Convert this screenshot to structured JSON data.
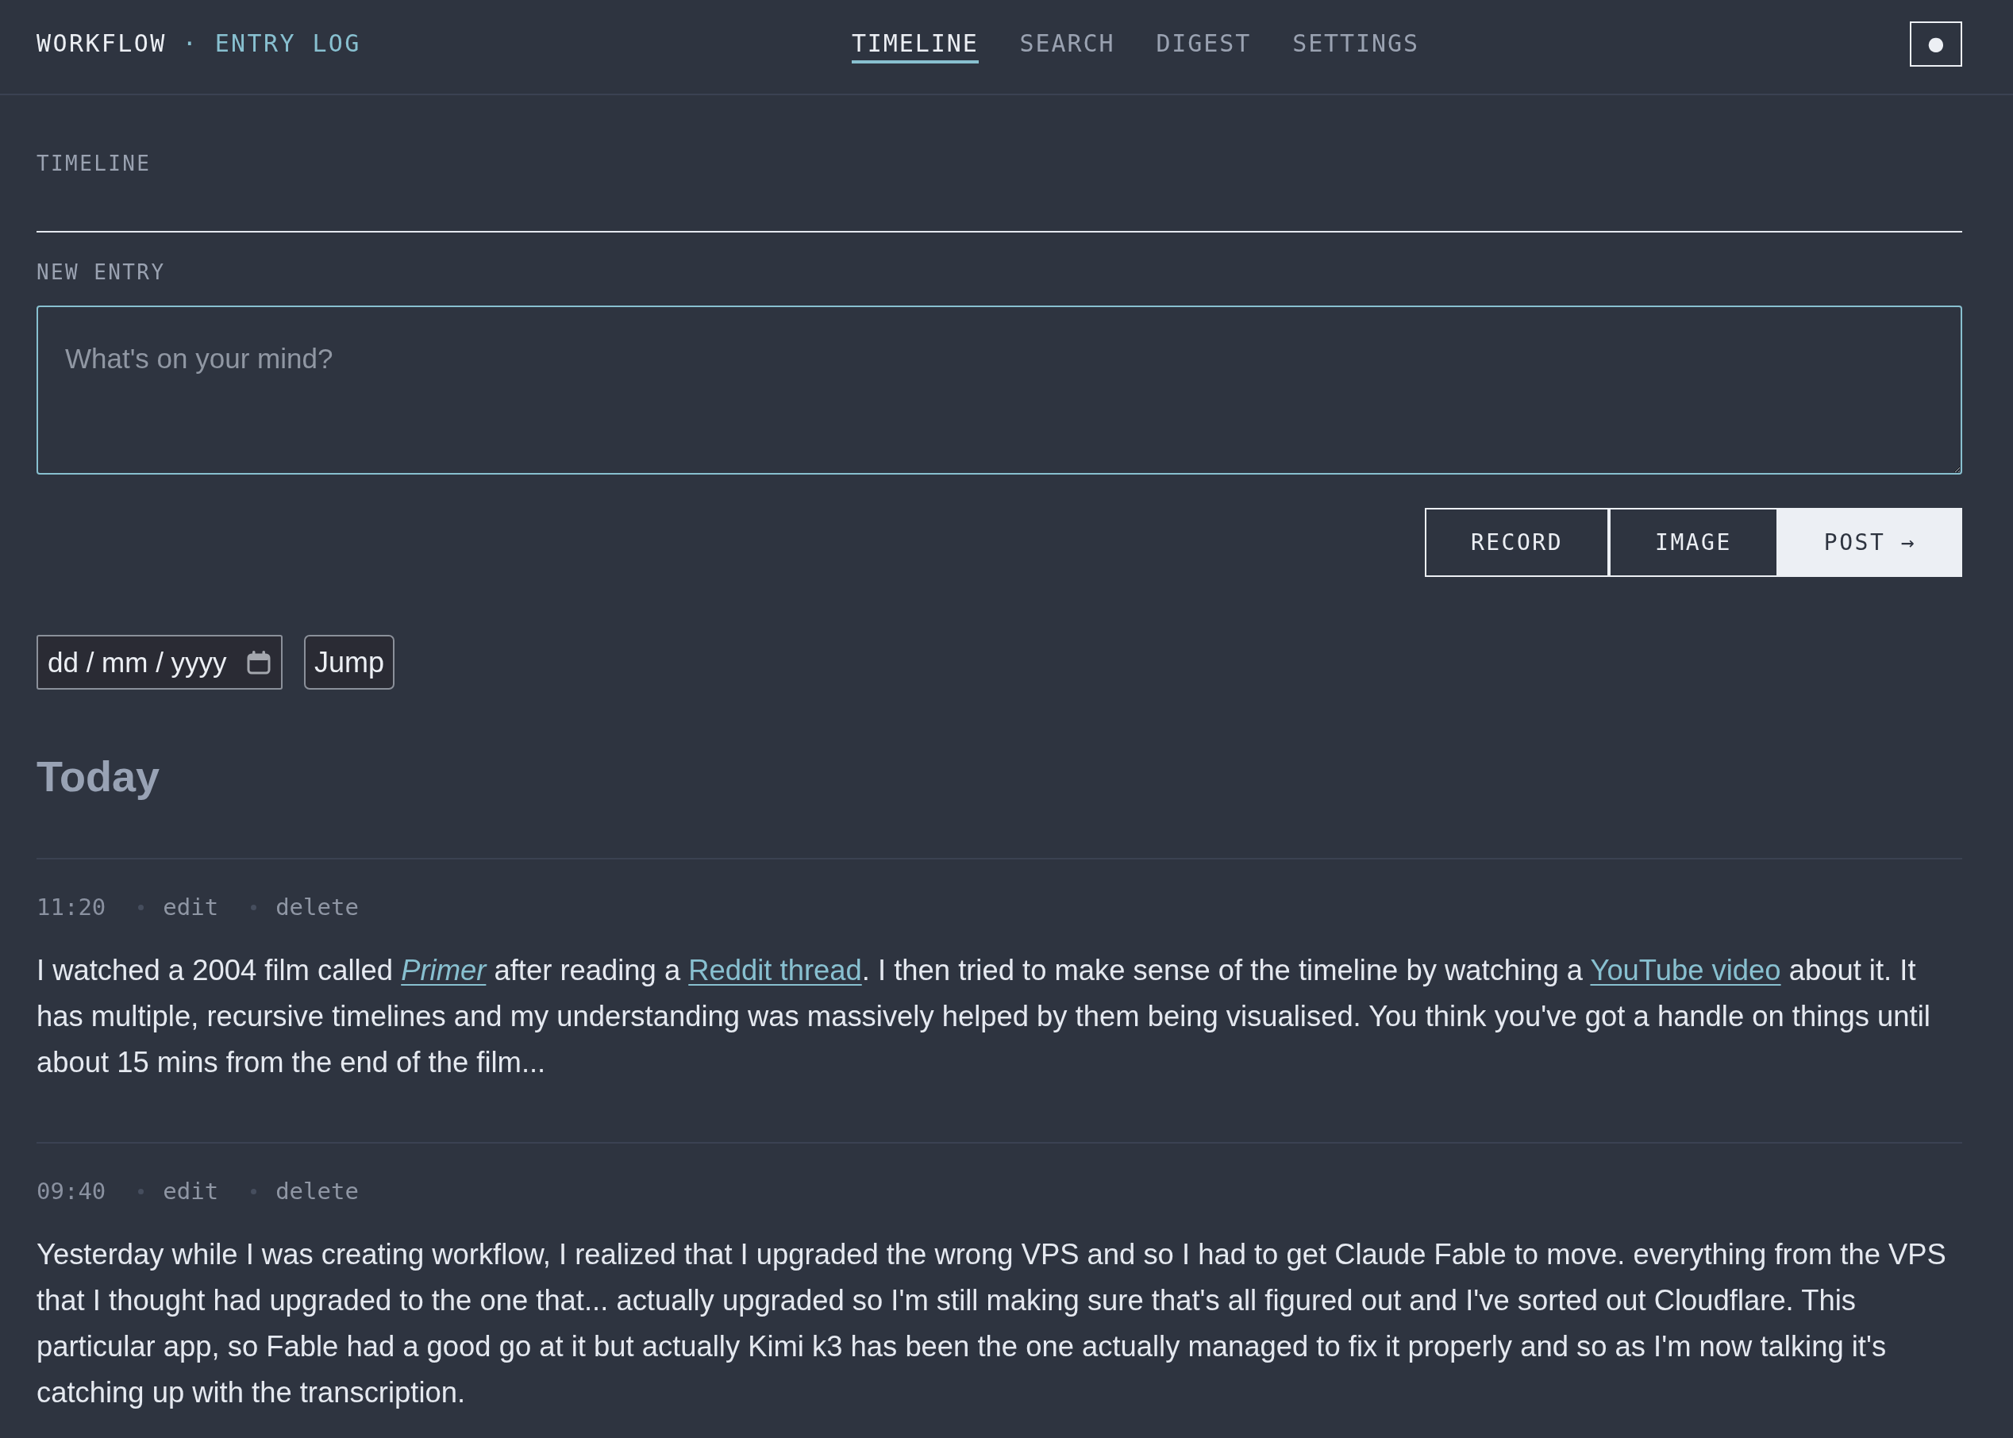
{
  "header": {
    "brand": {
      "name": "WORKFLOW",
      "subtitle": "· ENTRY LOG"
    },
    "nav": [
      {
        "label": "TIMELINE",
        "selected": true
      },
      {
        "label": "SEARCH",
        "selected": false
      },
      {
        "label": "DIGEST",
        "selected": false
      },
      {
        "label": "SETTINGS",
        "selected": false
      }
    ],
    "theme_toggle": {
      "label": "●"
    }
  },
  "page_title": "TIMELINE",
  "composer": {
    "label": "NEW ENTRY",
    "placeholder": "What's on your mind?",
    "buttons": [
      {
        "label": "RECORD",
        "kind": "secondary"
      },
      {
        "label": "IMAGE",
        "kind": "secondary"
      },
      {
        "label": "POST →",
        "kind": "primary"
      }
    ]
  },
  "date_jump": {
    "placeholder": "dd / mm / yyyy",
    "button": "Jump"
  },
  "day_heading": "Today",
  "entries": [
    {
      "time": "11:20",
      "actions": [
        "edit",
        "delete"
      ],
      "body": [
        {
          "kind": "text",
          "text": "I watched a 2004 film called "
        },
        {
          "kind": "link",
          "text": "Primer",
          "italic": true
        },
        {
          "kind": "text",
          "text": " after reading a "
        },
        {
          "kind": "link",
          "text": "Reddit thread",
          "italic": false
        },
        {
          "kind": "text",
          "text": ". I then tried to make sense of the timeline by watching a "
        },
        {
          "kind": "link",
          "text": "YouTube video",
          "italic": false
        },
        {
          "kind": "text",
          "text": " about it. It has multiple, recursive timelines and my understanding was massively helped by them being visualised. You think you've got a handle on things until about 15 mins from the end of the film..."
        }
      ]
    },
    {
      "time": "09:40",
      "actions": [
        "edit",
        "delete"
      ],
      "body": [
        {
          "kind": "text",
          "text": "Yesterday while I was creating workflow, I realized that I upgraded the wrong VPS and so I had to get Claude Fable to move. everything from the VPS that I thought had upgraded to the one that... actually upgraded so I'm still making sure that's all figured out and I've sorted out Cloudflare. This particular app, so Fable had a good go at it but actually Kimi k3 has been the one actually managed to fix it properly and so as I'm now talking it's catching up with the transcription."
        }
      ]
    }
  ]
}
